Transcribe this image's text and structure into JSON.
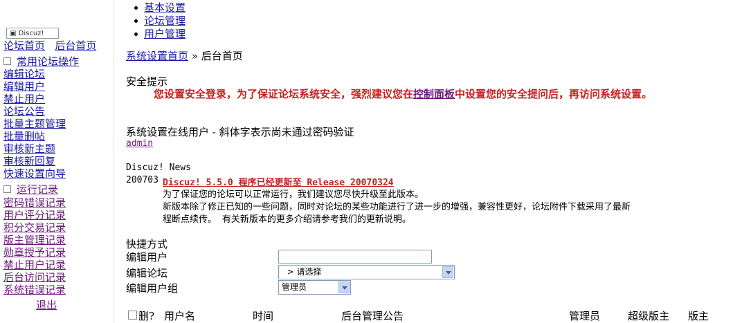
{
  "top_nav": [
    "基本设置",
    "论坛管理",
    "用户管理"
  ],
  "sidebar": {
    "logo_text": "Discuz!",
    "forum_home": "论坛首页",
    "admin_home": "后台首页",
    "section1_title": "常用论坛操作",
    "section1_items": [
      "编辑论坛",
      "编辑用户",
      "禁止用户",
      "论坛公告",
      "批量主题管理",
      "批量删帖",
      "审核新主题",
      "审核新回复",
      "快速设置向导"
    ],
    "section2_title": "运行记录",
    "section2_items": [
      "密码错误记录",
      "用户评分记录",
      "积分交易记录",
      "版主管理记录",
      "勋章授予记录",
      "禁止用户记录",
      "后台访问记录",
      "系统错误记录"
    ],
    "logout": "退出"
  },
  "breadcrumb": {
    "link": "系统设置首页",
    "sep": "»",
    "current": "后台首页"
  },
  "security": {
    "title": "安全提示",
    "before": "您设置安全登录，为了保证论坛系统安全，强烈建议您在",
    "link": "控制面板",
    "after": "中设置您的安全提问后，再访问系统设置。"
  },
  "online": {
    "title": "系统设置在线用户 - 斜体字表示尚未通过密码验证",
    "user": "admin"
  },
  "news": {
    "title": "Discuz! News",
    "date": "200703",
    "headline": "Discuz! 5.5.0 程序已经更新至 Release 20070324",
    "line1": "为了保证您的论坛可以正常运行，我们建议您尽快升级至此版本。",
    "line2": "新版本除了修正已知的一些问题，同时对论坛的某些功能进行了进一步的增强，兼容性更好，论坛附件下载采用了最新",
    "line3": "程断点续传。  有关新版本的更多介绍请参考我们的更新说明。"
  },
  "shortcuts": {
    "title": "快捷方式",
    "edit_user_label": "编辑用户",
    "edit_user_value": "",
    "edit_forum_label": "编辑论坛",
    "edit_forum_selected": "  > 请选择",
    "edit_group_label": "编辑用户组",
    "edit_group_selected": "管理员"
  },
  "notice_table": {
    "headers": [
      "删?",
      "用户名",
      "时间",
      "后台管理公告",
      "管理员",
      "超级版主",
      "版主"
    ]
  },
  "colors": {
    "link": "#1a1aa8",
    "visited": "#6a1b78",
    "warning": "#c62020"
  }
}
